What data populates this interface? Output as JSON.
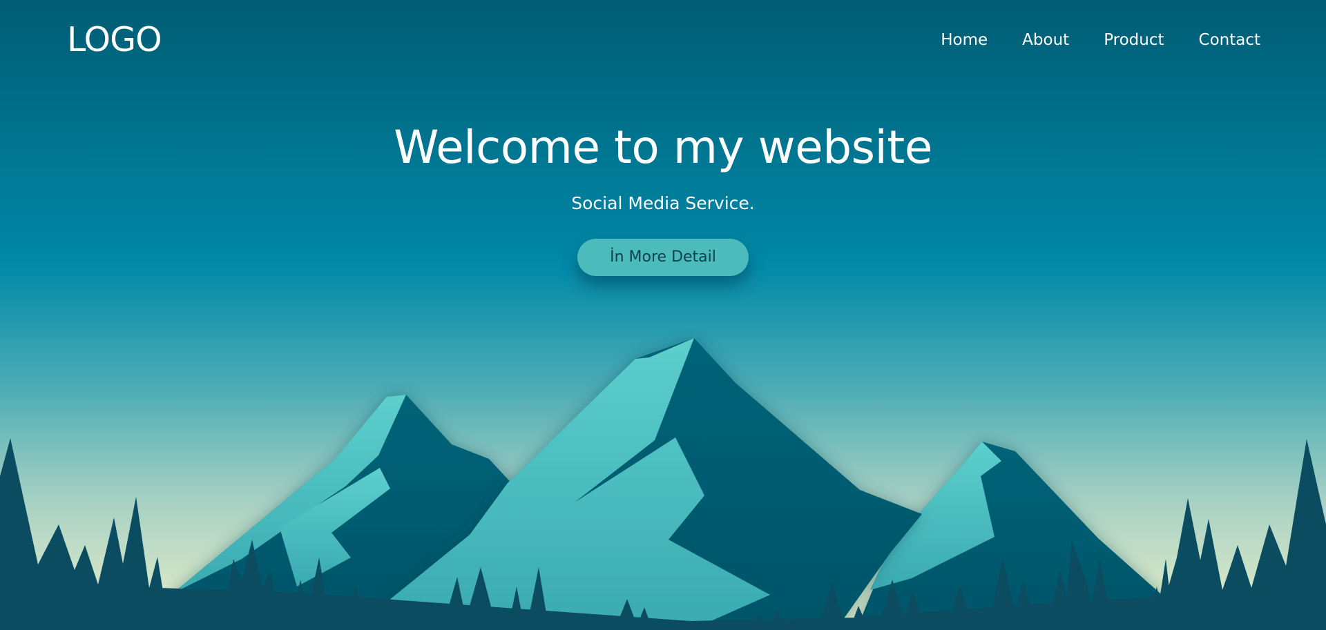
{
  "brand": {
    "logo_text": "LOGO"
  },
  "nav": {
    "items": [
      {
        "label": "Home"
      },
      {
        "label": "About"
      },
      {
        "label": "Product"
      },
      {
        "label": "Contact"
      }
    ]
  },
  "hero": {
    "title": "Welcome to my website",
    "subtitle": "Social Media Service.",
    "button_label": "İn More Detail"
  },
  "colors": {
    "sky_top": "#005c73",
    "sky_mid": "#0089a8",
    "horizon": "#c9e3c8",
    "mountain_light": "#52c6c6",
    "mountain_dark": "#005e74",
    "trees": "#0b4c60",
    "button_bg": "#4bbcbb",
    "button_text": "#0f3f4d"
  }
}
